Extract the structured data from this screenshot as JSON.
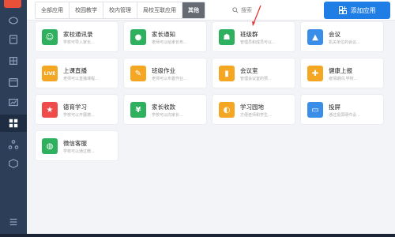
{
  "topbar": {
    "tabs": [
      "全部应用",
      "校园教学",
      "校内管理",
      "局校互联应用",
      "其他"
    ],
    "active_tab": 4,
    "search_label": "搜索",
    "add_button_label": "添加应用"
  },
  "colors": {
    "accent": "#1f7de6",
    "sidebar": "#2c3e58",
    "green": "#2fb05f",
    "blue": "#3b8ee8",
    "orange": "#f5a623",
    "red": "#ef4b4b"
  },
  "apps": [
    {
      "title": "家校通讯录",
      "desc": "学校可导入家长...",
      "icon": "contacts-icon",
      "color": "#2fb05f"
    },
    {
      "title": "家长通知",
      "desc": "老师可以给家长布...",
      "icon": "chat-bubble-icon",
      "color": "#2fb05f"
    },
    {
      "title": "班级群",
      "desc": "管理员和成员可以...",
      "icon": "group-icon",
      "color": "#2fb05f"
    },
    {
      "title": "会议",
      "desc": "机关单位的会议...",
      "icon": "meeting-icon",
      "color": "#3b8ee8"
    },
    {
      "title": "上课直播",
      "desc": "老师可以直播课程...",
      "icon": "live-icon",
      "icon_text": "LIVE",
      "color": "#f5a623"
    },
    {
      "title": "班级作业",
      "desc": "老师可以布置作业...",
      "icon": "homework-icon",
      "color": "#f5a623"
    },
    {
      "title": "会议室",
      "desc": "管理会议室的预...",
      "icon": "door-icon",
      "color": "#f5a623"
    },
    {
      "title": "健康上报",
      "desc": "疫情期间,学校...",
      "icon": "health-icon",
      "color": "#f5a623"
    },
    {
      "title": "德育学习",
      "desc": "学校可以开展德...",
      "icon": "star-icon",
      "color": "#ef4b4b"
    },
    {
      "title": "家长收款",
      "desc": "学校可以向家长...",
      "icon": "payment-icon",
      "color": "#2fb05f"
    },
    {
      "title": "学习园地",
      "desc": "方便老师和学生...",
      "icon": "planet-icon",
      "color": "#f5a623"
    },
    {
      "title": "投屏",
      "desc": "通过投屏硬件设...",
      "icon": "cast-icon",
      "color": "#3b8ee8"
    },
    {
      "title": "微信客服",
      "desc": "学校可以通过微...",
      "icon": "wechat-service-icon",
      "color": "#2fb05f"
    }
  ]
}
